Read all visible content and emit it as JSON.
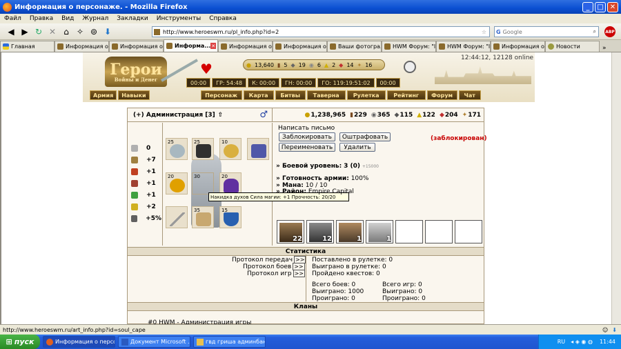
{
  "window": {
    "title": "Информация о персонаже. - Mozilla Firefox"
  },
  "menu": [
    "Файл",
    "Правка",
    "Вид",
    "Журнал",
    "Закладки",
    "Инструменты",
    "Справка"
  ],
  "nav": {
    "url": "http://www.heroeswm.ru/pl_info.php?id=2",
    "search_placeholder": "Google"
  },
  "tabs": [
    {
      "label": "Главная",
      "active": false
    },
    {
      "label": "Информация о ...",
      "active": false
    },
    {
      "label": "Информация о ...",
      "active": false
    },
    {
      "label": "Информа...",
      "active": true
    },
    {
      "label": "Информация о ...",
      "active": false
    },
    {
      "label": "Информация о ...",
      "active": false
    },
    {
      "label": "Ваши фотогра...",
      "active": false
    },
    {
      "label": "HWM Форум: \"l...",
      "active": false
    },
    {
      "label": "HWM Форум: \"l...",
      "active": false
    },
    {
      "label": "Информация о ...",
      "active": false
    },
    {
      "label": "Новости",
      "active": false
    }
  ],
  "header": {
    "logo_title": "Герои",
    "logo_subtitle": "Войны и Денег",
    "server_time": "12:44:12, 12128 online",
    "resources": [
      "13,640",
      "5",
      "19",
      "6",
      "2",
      "14",
      "16"
    ],
    "timers": [
      "00:00",
      "ГР: 54:48",
      "К: 00:00",
      "ГН: 00:00",
      "ГО: 119:19:51:02",
      "00:00"
    ],
    "left_nav": [
      "Армия",
      "Навыки"
    ],
    "main_nav": [
      "Персонаж",
      "Карта",
      "Битвы",
      "Таверна",
      "Рулетка",
      "Рейтинг",
      "Форум",
      "Чат"
    ]
  },
  "player": {
    "name_line": "(+) Администрация [3]",
    "gold": "1,238,965",
    "wood": "229",
    "ore": "204",
    "mercury": "365",
    "sulfur": "115",
    "crystals": "122",
    "gems": "204",
    "diamonds": "171"
  },
  "stats": [
    {
      "icon": "attack-icon",
      "value": "0",
      "color": "#b0b0b0"
    },
    {
      "icon": "defense-icon",
      "value": "+7",
      "color": "#a08040"
    },
    {
      "icon": "magic-icon",
      "value": "+1",
      "color": "#c04020"
    },
    {
      "icon": "knowledge-icon",
      "value": "+1",
      "color": "#a04030"
    },
    {
      "icon": "luck-icon",
      "value": "+1",
      "color": "#40a040"
    },
    {
      "icon": "morale-icon",
      "value": "+2",
      "color": "#d0b020"
    },
    {
      "icon": "initiative-icon",
      "value": "+5%",
      "color": "#606060"
    }
  ],
  "equipment": [
    {
      "level": "25"
    },
    {
      "level": "25"
    },
    {
      "level": "10"
    },
    {
      "level": ""
    },
    {
      "level": "20"
    },
    {
      "level": "30"
    },
    {
      "level": "20"
    },
    {
      "level": ""
    },
    {
      "level": "35"
    },
    {
      "level": "15"
    }
  ],
  "tooltip": "Накидка духов Сила магии: +1 Прочность: 20/20",
  "actions": {
    "write_letter": "Написать письмо",
    "block": "Заблокировать",
    "fine": "Оштрафовать",
    "rename": "Переименовать",
    "delete": "Удалить",
    "status": "(заблокирован)"
  },
  "info": {
    "combat_label": "» Боевой уровень:",
    "combat_value": "3 (0)",
    "combat_small": "+15000",
    "readiness_label": "» Готовность армии:",
    "readiness_value": "100%",
    "mana_label": "» Мана:",
    "mana_value": "10 / 10",
    "district_label": "» Район:",
    "district_value": "Empire Capital"
  },
  "army": [
    "22",
    "12",
    "1",
    "1",
    "",
    "",
    ""
  ],
  "statistics": {
    "title": "Статистика",
    "protocol_transfers": "Протокол передач",
    "protocol_battles": "Протокол боев",
    "protocol_games": "Протокол игр",
    "link": ">>",
    "roulette_bet": "Поставлено в рулетке: 0",
    "roulette_won": "Выиграно в рулетке: 0",
    "quests": "Пройдено квестов: 0",
    "battles_total": "Всего боев: 0",
    "battles_won": "Выиграно: 1000",
    "battles_lost": "Проиграно: 0",
    "games_total": "Всего игр: 0",
    "games_won": "Выиграно: 0",
    "games_lost": "Проиграно: 0"
  },
  "clans": {
    "title": "Кланы",
    "first": "#0 HWM - Администрация игры"
  },
  "statusbar": "http://www.heroeswm.ru/art_info.php?id=soul_cape",
  "taskbar": {
    "start": "пуск",
    "tasks": [
      "Информация о персо...",
      "Документ Microsoft ...",
      "гвд гриша админбан..."
    ],
    "lang": "RU",
    "time": "11:44"
  }
}
